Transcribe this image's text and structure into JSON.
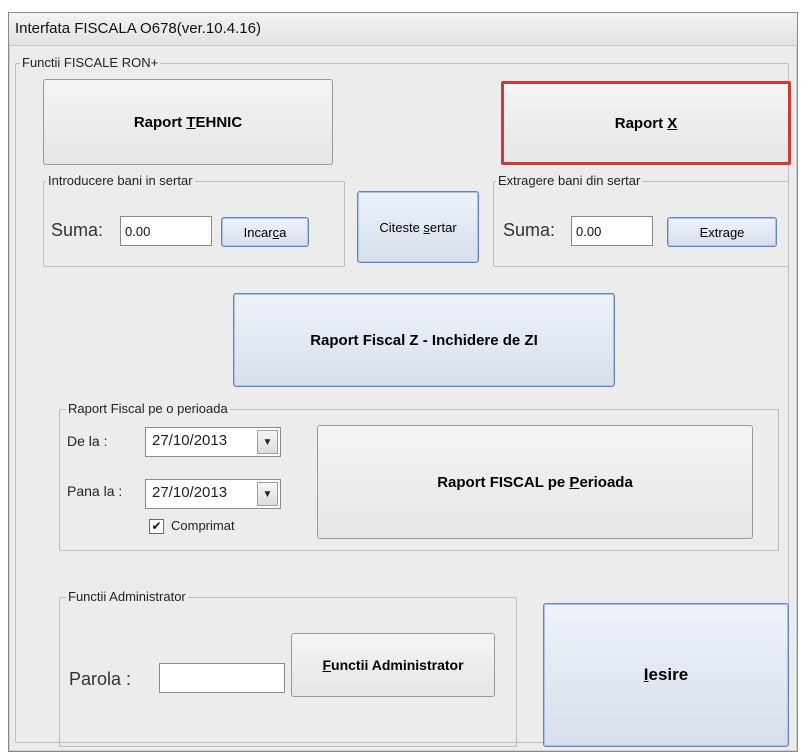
{
  "window": {
    "title": "Interfata FISCALA  O678(ver.10.4.16)"
  },
  "main_group": {
    "legend": "Functii FISCALE RON+"
  },
  "buttons": {
    "raport_tehnic": {
      "pre": "Raport ",
      "key": "T",
      "post": "EHNIC"
    },
    "raport_x": {
      "pre": "Raport ",
      "key": "X",
      "post": ""
    },
    "incarca": {
      "pre": "Incar",
      "key": "c",
      "post": "a"
    },
    "citeste_sertar": {
      "pre": "Citeste ",
      "key": "s",
      "post": "ertar"
    },
    "extrage": {
      "pre": "Extra",
      "key": "g",
      "post": "e"
    },
    "raport_z": "Raport Fiscal Z - Inchidere de ZI",
    "raport_perioada": {
      "pre": "Raport FISCAL pe ",
      "key": "P",
      "post": "erioada"
    },
    "functii_admin": {
      "pre": "",
      "key": "F",
      "post": "unctii Administrator"
    },
    "iesire": {
      "pre": "",
      "key": "I",
      "post": "esire"
    }
  },
  "deposit": {
    "legend": "Introducere bani in sertar",
    "suma_label": "Suma:",
    "suma_value": "0.00"
  },
  "withdraw": {
    "legend": "Extragere bani din sertar",
    "suma_label": "Suma:",
    "suma_value": "0.00"
  },
  "period": {
    "legend": "Raport Fiscal pe o perioada",
    "from_label": "De la :",
    "from_value": "27/10/2013",
    "to_label": "Pana la :",
    "to_value": "27/10/2013",
    "compressed_label": "Comprimat",
    "compressed_checked": true
  },
  "admin": {
    "legend": "Functii Administrator",
    "password_label": "Parola :",
    "password_value": ""
  }
}
